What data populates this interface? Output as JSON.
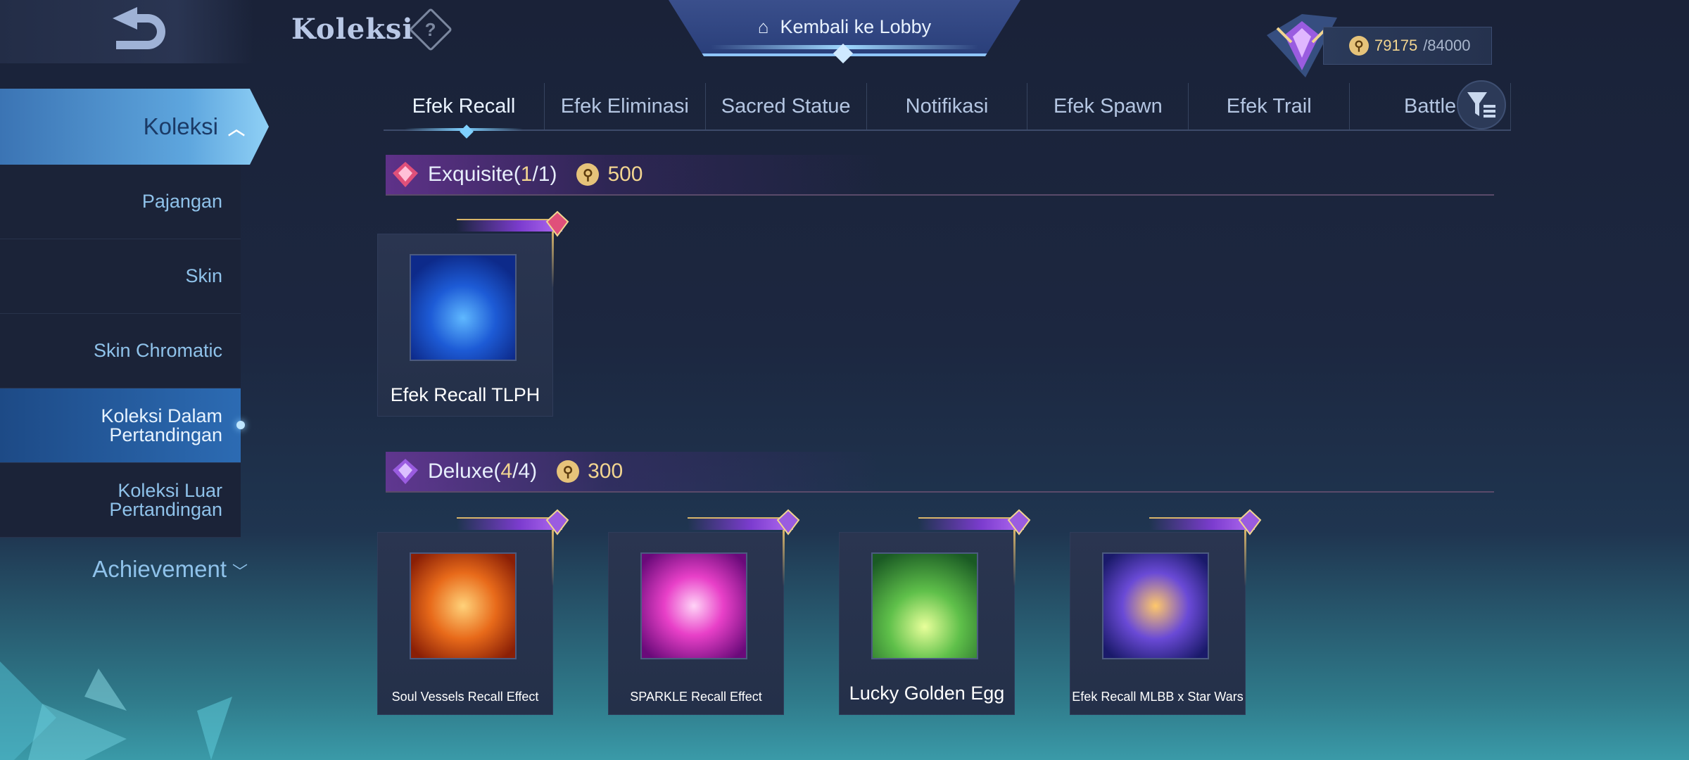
{
  "header": {
    "title": "Koleksi",
    "help_symbol": "?",
    "lobby_label": "Kembali ke Lobby",
    "currency": {
      "current": "79175",
      "max": "/84000"
    }
  },
  "sidebar": {
    "main_label": "Koleksi",
    "items": [
      {
        "label": "Pajangan"
      },
      {
        "label": "Skin"
      },
      {
        "label": "Skin Chromatic"
      },
      {
        "label": "Koleksi Dalam Pertandingan"
      },
      {
        "label": "Koleksi Luar Pertandingan"
      }
    ],
    "achievement_label": "Achievement"
  },
  "tabs": [
    {
      "label": "Efek Recall"
    },
    {
      "label": "Efek Eliminasi"
    },
    {
      "label": "Sacred Statue"
    },
    {
      "label": "Notifikasi"
    },
    {
      "label": "Efek Spawn"
    },
    {
      "label": "Efek Trail"
    },
    {
      "label": "Battle"
    }
  ],
  "sections": [
    {
      "name": "Exquisite",
      "count_open": "(",
      "owned": "1",
      "count_mid": "/1)",
      "price": "500",
      "items": [
        {
          "caption": "Efek Recall TLPH"
        }
      ]
    },
    {
      "name": "Deluxe",
      "count_open": "(",
      "owned": "4",
      "count_mid": "/4)",
      "price": "300",
      "items": [
        {
          "caption": "Soul Vessels Recall Effect"
        },
        {
          "caption": "SPARKLE Recall Effect"
        },
        {
          "caption": "Lucky Golden Egg"
        },
        {
          "caption": "Efek Recall MLBB x Star Wars"
        }
      ]
    }
  ],
  "colors": {
    "accent_gold": "#f2d590",
    "accent_blue": "#7fd0ff",
    "exquisite_gem": "#e0507a",
    "deluxe_gem": "#9a5ce0"
  }
}
